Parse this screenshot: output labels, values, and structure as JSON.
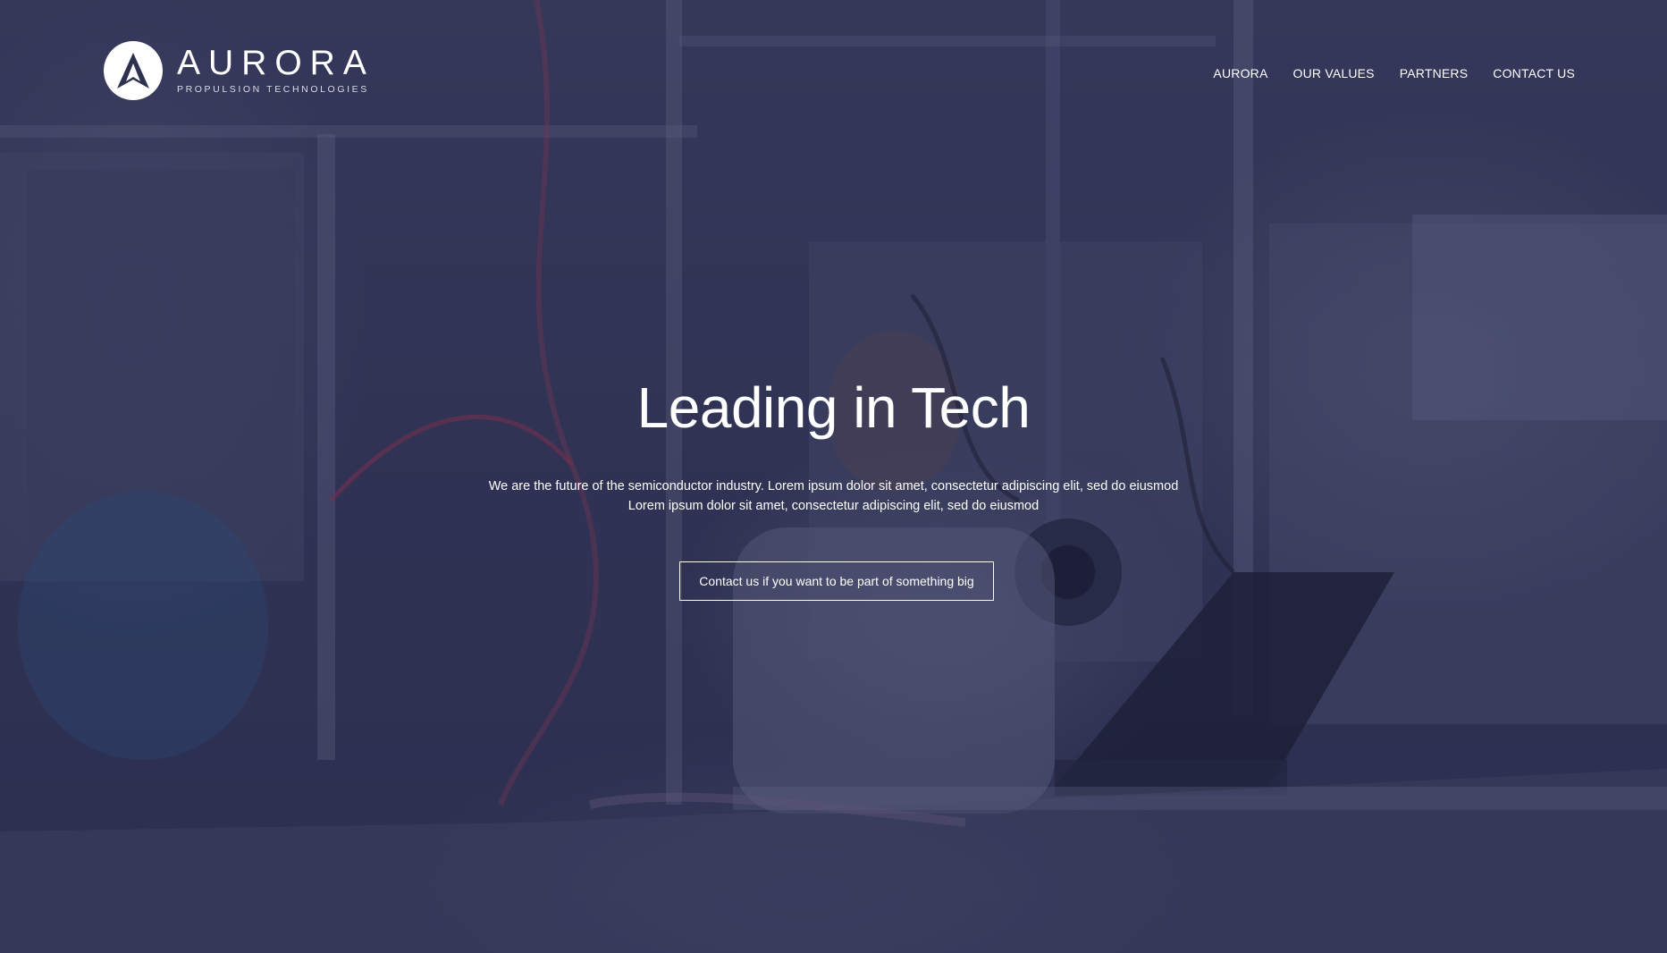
{
  "brand": {
    "name": "AURORA",
    "tagline": "PROPULSION TECHNOLOGIES",
    "logo_icon": "aurora-arrow-logo"
  },
  "nav": {
    "items": [
      {
        "label": "AURORA"
      },
      {
        "label": "OUR VALUES"
      },
      {
        "label": "PARTNERS"
      },
      {
        "label": "CONTACT US"
      }
    ]
  },
  "hero": {
    "title": "Leading in Tech",
    "subtitle_line1": "We are the future of the semiconductor industry. Lorem ipsum dolor sit amet, consectetur adipiscing elit, sed do eiusmod",
    "subtitle_line2": "Lorem ipsum dolor sit amet, consectetur adipiscing elit, sed do eiusmod",
    "cta_label": "Contact us if you want to be part of something big"
  },
  "colors": {
    "overlay": "#2e3150",
    "text": "#ffffff"
  }
}
